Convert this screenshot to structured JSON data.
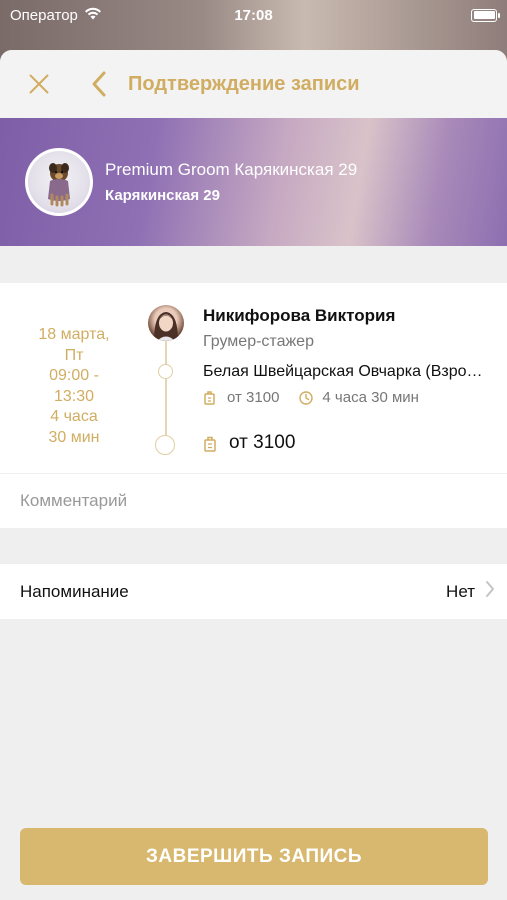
{
  "status_bar": {
    "carrier": "Оператор",
    "time": "17:08"
  },
  "navbar": {
    "title": "Подтверждение записи"
  },
  "salon": {
    "name": "Premium Groom Карякинская 29",
    "address": "Карякинская 29"
  },
  "booking": {
    "date": "18 марта,",
    "weekday": "Пт",
    "time_start": "09:00 -",
    "time_end": "13:30",
    "duration_hours": "4 часа",
    "duration_minutes": "30 мин",
    "master_name": "Никифорова Виктория",
    "master_role": "Грумер-стажер",
    "service_name": "Белая Швейцарская Овчарка (Взрослая)",
    "service_price": "от 3100",
    "service_duration": "4 часа 30 мин",
    "total_price": "от 3100"
  },
  "comment": {
    "placeholder": "Комментарий",
    "value": ""
  },
  "reminder": {
    "label": "Напоминание",
    "value": "Нет"
  },
  "actions": {
    "finish_label": "ЗАВЕРШИТЬ ЗАПИСЬ"
  },
  "colors": {
    "accent": "#d1ad62",
    "button": "#d7b86e",
    "background": "#efefef"
  },
  "icons": {
    "close": "close-icon",
    "back": "chevron-left-icon",
    "price": "price-tag-icon",
    "clock": "clock-icon",
    "chevron": "chevron-right-icon"
  }
}
